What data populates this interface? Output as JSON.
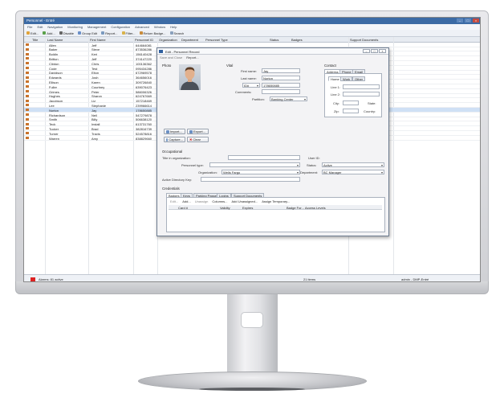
{
  "app": {
    "title": "Personnel - Entré",
    "menu": [
      "File",
      "Edit",
      "Navigation",
      "Monitoring",
      "Management",
      "Configuration",
      "Advanced",
      "Window",
      "Help"
    ],
    "toolbar": [
      "Edit...",
      "Add...",
      "Disable",
      "Group Edit",
      "Report...",
      "Filter...",
      "Return Badge...",
      "Search"
    ],
    "columns": [
      "Title",
      "Last Name",
      "First Name",
      "Personnel ID",
      "Organization",
      "Department",
      "Personnel Type",
      "Status",
      "Badges",
      "Support Documents"
    ],
    "rows": [
      {
        "last": "Allen",
        "first": "Jeff",
        "id": "644664081"
      },
      {
        "last": "Baker",
        "first": "Steve",
        "id": "873536286"
      },
      {
        "last": "Boldin",
        "first": "Keri",
        "id": "156140428"
      },
      {
        "last": "Britton",
        "first": "Jeff",
        "id": "374147220"
      },
      {
        "last": "Clinton",
        "first": "Chris",
        "id": "100136362"
      },
      {
        "last": "Code",
        "first": "Test",
        "id": "095434286"
      },
      {
        "last": "Davidson",
        "first": "Elton",
        "id": "672969578"
      },
      {
        "last": "Edwards",
        "first": "Josh",
        "id": "364656016"
      },
      {
        "last": "Ellison",
        "first": "Karen",
        "id": "309726840"
      },
      {
        "last": "Fuller",
        "first": "Courtney",
        "id": "639076423"
      },
      {
        "last": "Grimes",
        "first": "Peter",
        "id": "586006326"
      },
      {
        "last": "Hughes",
        "first": "Sharon",
        "id": "624767669"
      },
      {
        "last": "Jacobson",
        "first": "Liz",
        "id": "157218469"
      },
      {
        "last": "Lee",
        "first": "Stephanie",
        "id": "239966614"
      },
      {
        "last": "Norton",
        "first": "Jay",
        "id": "178650885"
      },
      {
        "last": "Richardson",
        "first": "Neil",
        "id": "547279878"
      },
      {
        "last": "Smith",
        "first": "Billy",
        "id": "506638120"
      },
      {
        "last": "Teck",
        "first": "Install",
        "id": "613731760"
      },
      {
        "last": "Tucker",
        "first": "Brad",
        "id": "382816739"
      },
      {
        "last": "Turner",
        "first": "Travis",
        "id": "524578816"
      },
      {
        "last": "Warren",
        "first": "Amy",
        "id": "838829660"
      }
    ],
    "selected_row": 14,
    "status": {
      "alarms": "Alarms: 81 active",
      "items": "21 items",
      "user": "admin - DMP-Entré"
    }
  },
  "dialog": {
    "title": "Edit - Personnel Record",
    "tools": [
      "Save and Close",
      "Report..."
    ],
    "photo_label": "Photo",
    "vital_label": "Vital",
    "contact_label": "Contact",
    "first_name_label": "First name:",
    "first_name": "Jay",
    "last_name_label": "Last name:",
    "last_name": "Norton",
    "id_type": "ID#",
    "id_value": "178650885",
    "comments_label": "Comments:",
    "partition_label": "Partition:",
    "partition": "Banking Center",
    "import": "Import...",
    "export": "Export...",
    "capture": "Capture...",
    "clear": "Clear",
    "contact_tabs": [
      "Address",
      "Phone",
      "Email"
    ],
    "address_tabs": [
      "Home",
      "Work",
      "Other"
    ],
    "line1": "Line 1:",
    "line2": "Line 2:",
    "city": "City:",
    "state": "State:",
    "zip": "Zip:",
    "country": "Country:",
    "occupational_label": "Occupational",
    "title_in_org_label": "Title in organization:",
    "user_id_label": "User ID:",
    "personnel_type_label": "Personnel type:",
    "status_label": "Status:",
    "status": "Active",
    "organization_label": "Organization:",
    "organization": "Wells Fargo",
    "department_label": "Department:",
    "department": "BC Manager",
    "ad_key_label": "Active Directory Key:",
    "credentials_label": "Credentials",
    "cred_tabs": [
      "Badges",
      "Keys",
      "Parking Passes",
      "Logins",
      "Support Documents"
    ],
    "badge_tools": [
      "Edit...",
      "Add...",
      "Unassign",
      "Columns...",
      "Add Unassigned...",
      "Assign Temporary..."
    ],
    "badge_columns": [
      "Card #",
      "Validity",
      "Expires",
      "Badge For...",
      "Access Levels"
    ]
  }
}
